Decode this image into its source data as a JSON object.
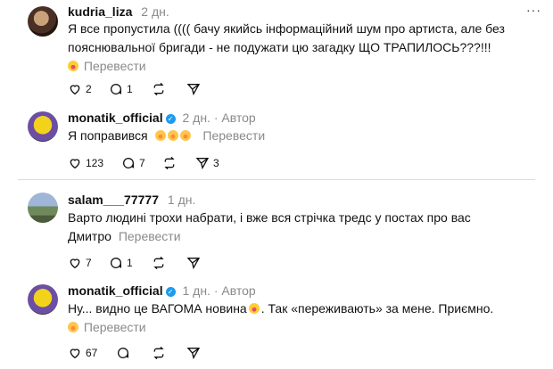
{
  "posts": [
    {
      "username": "kudria_liza",
      "time": "2 дн.",
      "text_line1": "Я все пропустила (((( бачу якийсь інформаційний шум про артиста, але без",
      "text_line2": "пояснювальної бригади - не подужати цю загадку ЩО ТРАПИЛОСЬ???!!!",
      "translate": "Перевести",
      "likes": "2",
      "comments": "1",
      "reposts": "",
      "shares": ""
    },
    {
      "username": "monatik_official",
      "time": "2 дн.",
      "author": "Автор",
      "text": "Я поправився",
      "translate": "Перевести",
      "likes": "123",
      "comments": "7",
      "reposts": "",
      "shares": "3"
    },
    {
      "username": "salam___77777",
      "time": "1 дн.",
      "text_line1": "Варто людині трохи набрати, і вже вся стрічка тредс у постах про вас",
      "text_line2": "Дмитро",
      "translate": "Перевести",
      "likes": "7",
      "comments": "1",
      "reposts": "",
      "shares": ""
    },
    {
      "username": "monatik_official",
      "time": "1 дн.",
      "author": "Автор",
      "text_line1a": "Ну... видно це ВАГОМА новина",
      "text_line1b": ". Так «переживають» за мене. Приємно.",
      "translate": "Перевести",
      "likes": "67",
      "comments": "",
      "reposts": "",
      "shares": ""
    }
  ],
  "more_label": "···",
  "separator": "·"
}
